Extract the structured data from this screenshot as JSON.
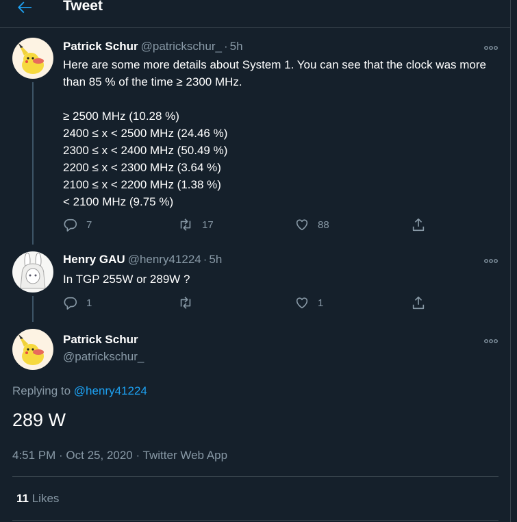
{
  "header": {
    "title": "Tweet",
    "back_icon": "arrow-left-icon"
  },
  "tweets": [
    {
      "name": "Patrick Schur",
      "handle": "@patrickschur_",
      "sep": "·",
      "time": "5h",
      "text": "Here are some more details about System 1. You can see that the clock was more than 85 % of the time ≥ 2300 MHz.\n\n≥ 2500 MHz (10.28 %)\n2400 ≤ x < 2500 MHz (24.46 %)\n2300 ≤ x < 2400 MHz (50.49 %)\n2200 ≤ x < 2300 MHz (3.64 %)\n2100 ≤ x < 2200 MHz (1.38 %)\n< 2100 MHz (9.75 %)",
      "replies": "7",
      "retweets": "17",
      "likes": "88"
    },
    {
      "name": "Henry GAU",
      "handle": "@henry41224",
      "sep": "·",
      "time": "5h",
      "text": "In TGP 255W or 289W ?",
      "replies": "1",
      "retweets": "",
      "likes": "1"
    }
  ],
  "focus": {
    "name": "Patrick Schur",
    "handle": "@patrickschur_",
    "replying_prefix": "Replying to",
    "replying_to": "@henry41224",
    "text": "289 W",
    "meta": "4:51 PM · Oct 25, 2020 · Twitter Web App",
    "likes_count": "11",
    "likes_label": "Likes"
  },
  "colors": {
    "background": "#15202b",
    "secondary": "#8899a6",
    "accent": "#1da1f2",
    "border": "#38444d"
  }
}
